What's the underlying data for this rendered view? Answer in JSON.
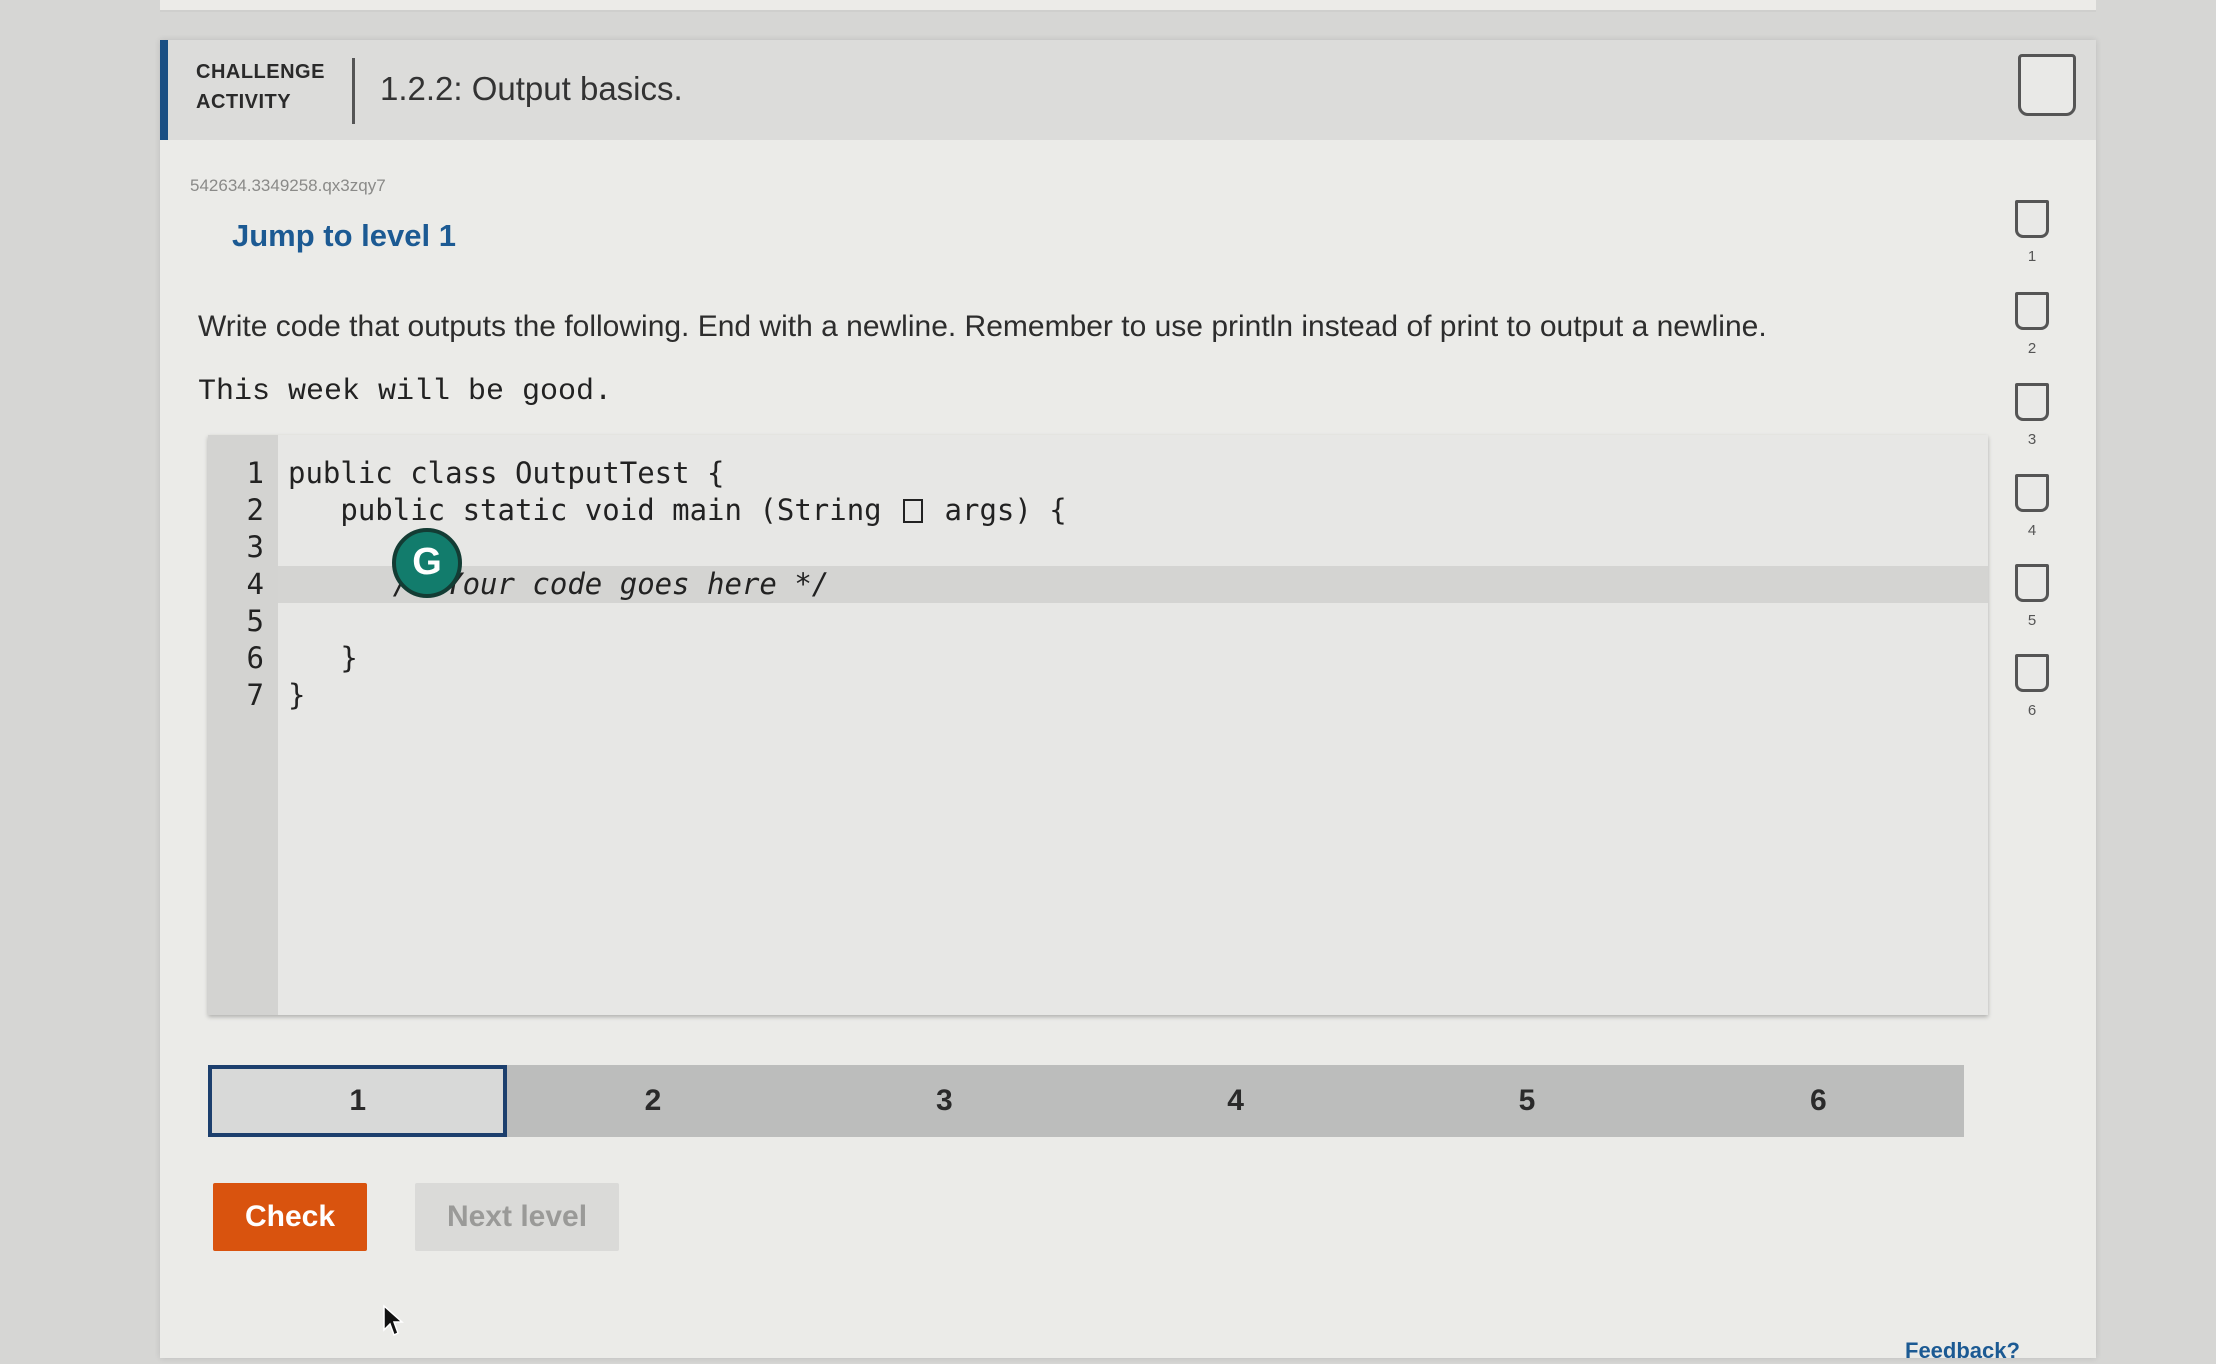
{
  "header": {
    "challenge_label": "CHALLENGE ACTIVITY",
    "title": "1.2.2: Output basics."
  },
  "activity_id": "542634.3349258.qx3zqy7",
  "jump_link": "Jump to level 1",
  "instructions": "Write code that outputs the following. End with a newline. Remember to use println instead of print to output a newline.",
  "expected_output": "This week will be good.",
  "editor": {
    "line_numbers": [
      "1",
      "2",
      "3",
      "4",
      "5",
      "6",
      "7"
    ],
    "lines": {
      "l1": "public class OutputTest {",
      "l2a": "   public static void main (String ",
      "l2b": " args) {",
      "l4": "      /* Your code goes here */",
      "l6": "   }",
      "l7": "}"
    },
    "active_line": "4"
  },
  "grammarly_badge": "G",
  "side_levels": [
    "1",
    "2",
    "3",
    "4",
    "5",
    "6"
  ],
  "level_tabs": [
    "1",
    "2",
    "3",
    "4",
    "5",
    "6"
  ],
  "current_level": "1",
  "buttons": {
    "check": "Check",
    "next_level": "Next level"
  },
  "feedback": "Feedback?",
  "colors": {
    "accent_blue": "#1c5a93",
    "check_orange": "#d9530e",
    "header_bar": "#1a4f83"
  }
}
